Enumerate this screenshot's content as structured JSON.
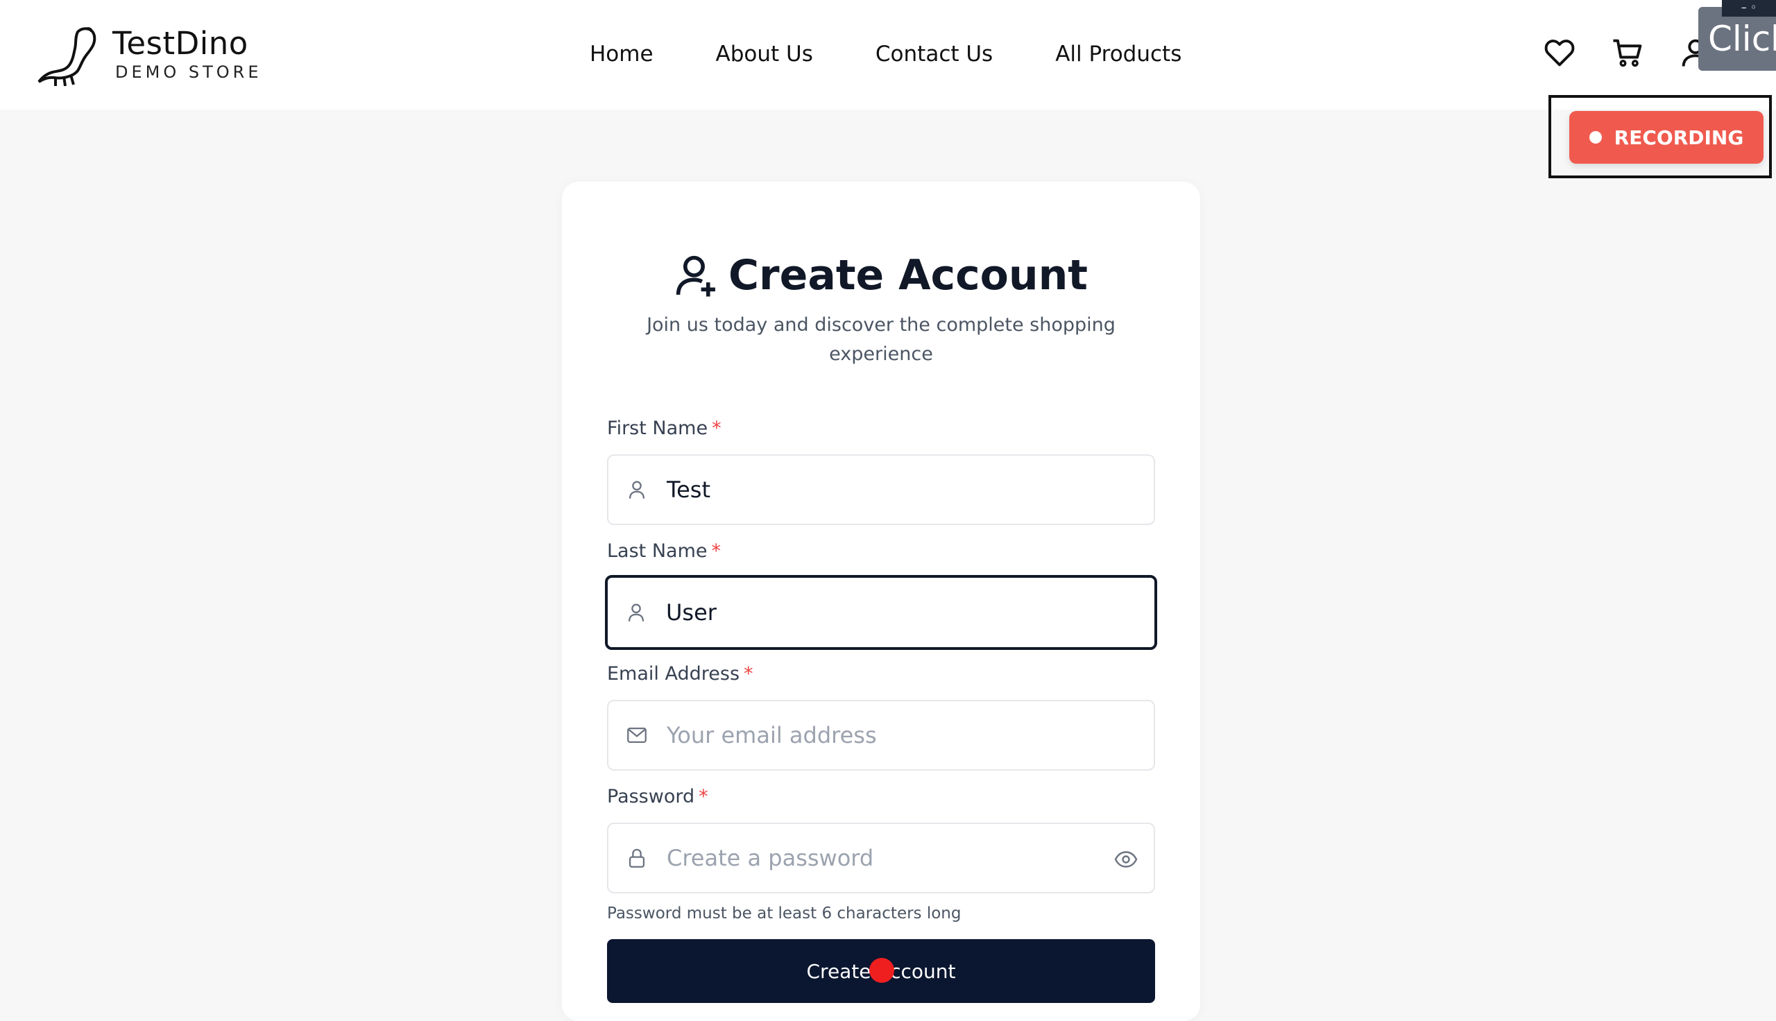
{
  "header": {
    "logo": {
      "title": "TestDino",
      "subtitle": "DEMO STORE"
    },
    "nav": [
      "Home",
      "About Us",
      "Contact Us",
      "All Products"
    ],
    "icons": [
      "heart-icon",
      "cart-icon",
      "user-icon"
    ]
  },
  "overlay": {
    "click_label": "Click",
    "window_controls": "– ◦",
    "recording_label": "RECORDING",
    "recording_color": "#f05a4e"
  },
  "form": {
    "title": "Create Account",
    "subtitle": "Join us today and discover the complete shopping experience",
    "required_mark": "*",
    "first_name": {
      "label": "First Name",
      "value": "Test"
    },
    "last_name": {
      "label": "Last Name",
      "value": "User"
    },
    "email": {
      "label": "Email Address",
      "placeholder": "Your email address"
    },
    "password": {
      "label": "Password",
      "placeholder": "Create a password",
      "hint": "Password must be at least 6 characters long"
    },
    "submit_label": "Create Account",
    "submit_color": "#0b1630"
  }
}
